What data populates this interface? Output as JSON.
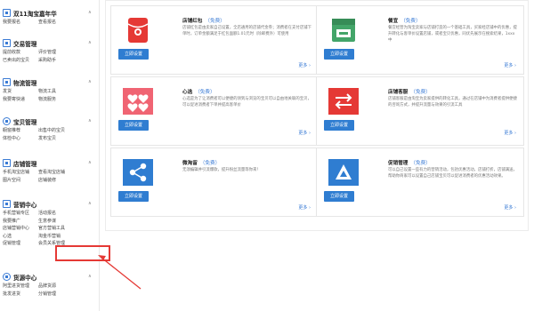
{
  "sidebar": {
    "sections": [
      {
        "title": "双11淘宝嘉年华",
        "links": [
          [
            "我要报名",
            "查看报名"
          ]
        ]
      },
      {
        "title": "交易管理",
        "links": [
          [
            "提前收款",
            "评价管理"
          ],
          [
            "已卖出的宝贝",
            "采购助手"
          ]
        ]
      },
      {
        "title": "物流管理",
        "links": [
          [
            "发货",
            "物流工具"
          ],
          [
            "我要寄快递",
            "物流服务"
          ]
        ]
      },
      {
        "title": "宝贝管理",
        "links": [
          [
            "橱窗推荐",
            "出售中的宝贝"
          ],
          [
            "体检中心",
            "发布宝贝"
          ]
        ]
      },
      {
        "title": "店铺管理",
        "links": [
          [
            "手机淘宝店铺",
            "查看淘宝店铺"
          ],
          [
            "图片空间",
            "店铺装修"
          ]
        ]
      },
      {
        "title": "营销中心",
        "links": [
          [
            "手机营销专区",
            "活动报名"
          ],
          [
            "我要推广",
            "生意参谋"
          ],
          [
            "店铺营销中心",
            "官方营销工具"
          ],
          [
            "心选",
            "淘金币营销"
          ],
          [
            "促销管理",
            "会员关系管理"
          ]
        ]
      },
      {
        "title": "货源中心",
        "links": [
          [
            "阿里进货管理",
            "品牌货源"
          ],
          [
            "批发进货",
            "分销管理"
          ]
        ]
      }
    ]
  },
  "cards": [
    {
      "title": "店铺红包",
      "tag": "（免费）",
      "desc": "店铺红包是由卖家自己设置，全店通用的店铺代金券；消费者在支付店铺下单时，订单金额满足于红包面额1.01元时（除邮费外）可使用",
      "button": "立即设置",
      "more": "更多 ›",
      "icon": "red-envelope-icon",
      "color": "#e53935"
    },
    {
      "title": "餐宜",
      "tag": "（免费）",
      "desc": "餐宜经营为淘宝卖家与店铺打造的一个基础工具，买家经店铺中的优惠，提升转化与客单价设置店铺，或者宝贝优惠，同优先展示在搜索结果，1xxx中",
      "button": "立即设置",
      "more": "更多 ›",
      "icon": "shop-window-icon",
      "color": "#43a569"
    },
    {
      "title": "心选",
      "tag": "（免费）",
      "desc": "心选是为了让消费者可以便捷的领到与浏览的宝贝可以自由地关联的宝贝，可以促进消费者下单并提高客单价",
      "button": "立即设置",
      "more": "更多 ›",
      "icon": "hearts-icon",
      "color": "#f06473"
    },
    {
      "title": "店铺客服",
      "tag": "（免费）",
      "desc": "店铺客服是由淘宝为卖家提供的转化工具，通过在店铺中为消费者提供便捷的咨询方式，并提升流量与效果的引流工具",
      "button": "立即设置",
      "more": "更多 ›",
      "icon": "transfer-arrows-icon",
      "color": "#e53935"
    },
    {
      "title": "微淘留",
      "tag": "（免费）",
      "desc": "无须编辑并引流爆款，提升粉丝流量等你来！",
      "button": "立即设置",
      "more": "更多 ›",
      "icon": "share-icon",
      "color": "#2f7dd1"
    },
    {
      "title": "促销管理",
      "tag": "（免费）",
      "desc": "可以自己设置一些有力的营销活动，包括优惠活动，店铺打折，店铺满送，帮助你商家可以设置自己店铺宝贝可以促进消费者的优惠活动效果。",
      "button": "立即设置",
      "more": "更多 ›",
      "icon": "triangle-icon",
      "color": "#2f7dd1"
    }
  ]
}
